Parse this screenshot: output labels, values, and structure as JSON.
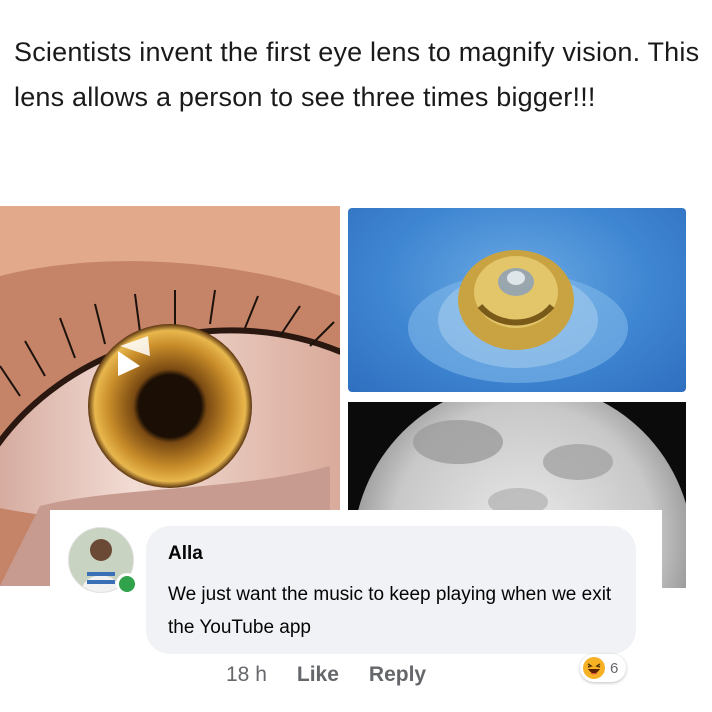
{
  "post": {
    "caption": "Scientists invent the first eye lens to magnify vision. This lens allows a person to see three times bigger!!!"
  },
  "images": {
    "eye": "close-up eye",
    "lens": "contact lens",
    "moon": "moon"
  },
  "comment": {
    "author": "Alla",
    "text": "We just want the music to keep playing when we exit the YouTube app",
    "time": "18 h",
    "like_label": "Like",
    "reply_label": "Reply",
    "reaction_icon": "haha-emoji-icon",
    "reaction_count": "6"
  },
  "colors": {
    "bubble_bg": "#f0f2f5",
    "online": "#31a24c",
    "meta_text": "#65676b"
  }
}
